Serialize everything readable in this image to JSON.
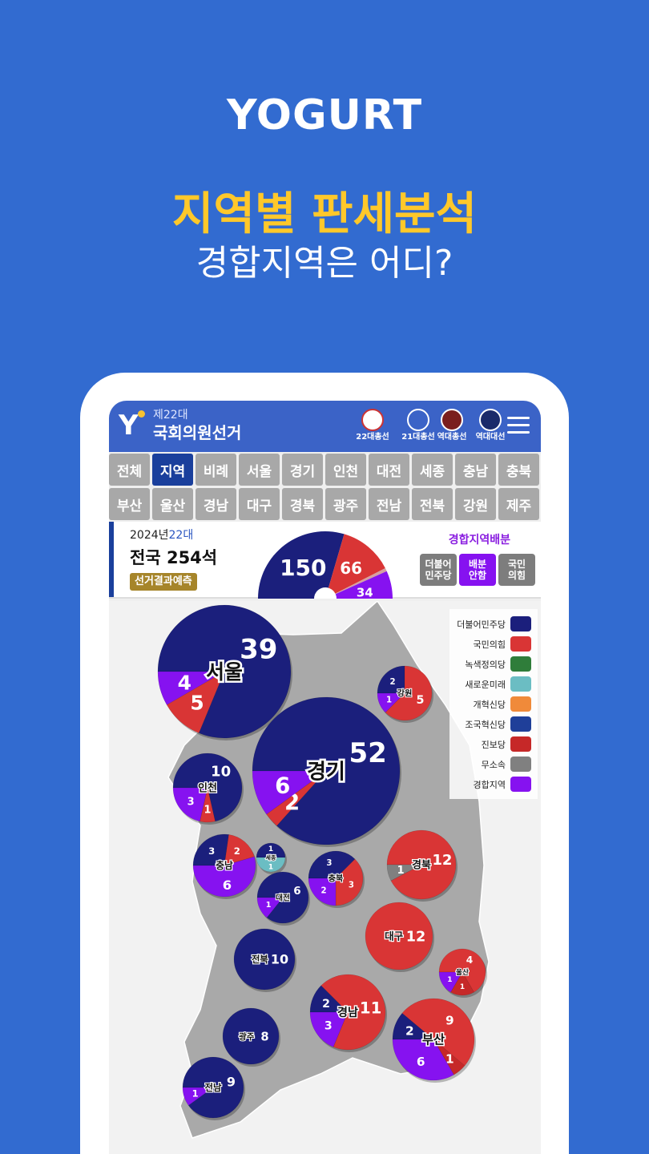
{
  "brand": "YOGURT",
  "headline": "지역별 판세분석",
  "subline": "경합지역은 어디?",
  "app": {
    "title_small": "제22대",
    "title": "국회의원선거",
    "icons": [
      {
        "name": "ballot-icon",
        "label": "22대총선"
      },
      {
        "name": "assembly-icon",
        "label": "21대총선"
      },
      {
        "name": "seal-icon",
        "label": "역대총선"
      },
      {
        "name": "emblem-icon",
        "label": "역대대선"
      }
    ]
  },
  "tabs": [
    [
      "전체",
      "지역",
      "비례",
      "서울",
      "경기",
      "인천",
      "대전",
      "세종",
      "충남",
      "충북"
    ],
    [
      "부산",
      "울산",
      "경남",
      "대구",
      "경북",
      "광주",
      "전남",
      "전북",
      "강원",
      "제주"
    ]
  ],
  "selected_tab": "지역",
  "summary": {
    "year": "2024년",
    "term": "22대",
    "total": "전국 254석",
    "predict": "선거결과예측",
    "contested_title": "경합지역배분",
    "buttons": [
      "더불어\n민주당",
      "배분\n안함",
      "국민\n의힘"
    ],
    "selected_button": "배분\n안함"
  },
  "colors": {
    "더불어민주당": "#1b1f7c",
    "국민의힘": "#d93535",
    "녹색정의당": "#2f7d3a",
    "새로운미래": "#6bbdc3",
    "개혁신당": "#f08a3a",
    "조국혁신당": "#1f3f99",
    "진보당": "#c62828",
    "무소속": "#808080",
    "경합지역": "#8612f0"
  },
  "legend": [
    "더불어민주당",
    "국민의힘",
    "녹색정의당",
    "새로운미래",
    "개혁신당",
    "조국혁신당",
    "진보당",
    "무소속",
    "경합지역"
  ],
  "chart_data": [
    {
      "type": "pie",
      "title": "전국 254석",
      "shape": "semicircle",
      "slices": [
        {
          "party": "더불어민주당",
          "value": 150
        },
        {
          "party": "국민의힘",
          "value": 66
        },
        {
          "party": "기타",
          "value": 4
        },
        {
          "party": "경합지역",
          "value": 34
        }
      ]
    },
    {
      "type": "pie",
      "regions": [
        {
          "region": "서울",
          "slices": [
            {
              "party": "더불어민주당",
              "value": 39
            },
            {
              "party": "국민의힘",
              "value": 5
            },
            {
              "party": "경합지역",
              "value": 4
            }
          ]
        },
        {
          "region": "강원",
          "slices": [
            {
              "party": "더불어민주당",
              "value": 2
            },
            {
              "party": "국민의힘",
              "value": 5
            },
            {
              "party": "경합지역",
              "value": 1
            }
          ]
        },
        {
          "region": "경기",
          "slices": [
            {
              "party": "더불어민주당",
              "value": 52
            },
            {
              "party": "국민의힘",
              "value": 2
            },
            {
              "party": "경합지역",
              "value": 6
            }
          ]
        },
        {
          "region": "인천",
          "slices": [
            {
              "party": "더불어민주당",
              "value": 10
            },
            {
              "party": "국민의힘",
              "value": 1
            },
            {
              "party": "경합지역",
              "value": 3
            }
          ]
        },
        {
          "region": "충남",
          "slices": [
            {
              "party": "더불어민주당",
              "value": 3
            },
            {
              "party": "국민의힘",
              "value": 2
            },
            {
              "party": "경합지역",
              "value": 6
            }
          ]
        },
        {
          "region": "세종",
          "slices": [
            {
              "party": "더불어민주당",
              "value": 1
            },
            {
              "party": "새로운미래",
              "value": 1
            }
          ]
        },
        {
          "region": "대전",
          "slices": [
            {
              "party": "더불어민주당",
              "value": 6
            },
            {
              "party": "경합지역",
              "value": 1
            }
          ]
        },
        {
          "region": "충북",
          "slices": [
            {
              "party": "더불어민주당",
              "value": 3
            },
            {
              "party": "국민의힘",
              "value": 3
            },
            {
              "party": "경합지역",
              "value": 2
            }
          ]
        },
        {
          "region": "경북",
          "slices": [
            {
              "party": "국민의힘",
              "value": 12
            },
            {
              "party": "무소속",
              "value": 1
            }
          ]
        },
        {
          "region": "대구",
          "slices": [
            {
              "party": "국민의힘",
              "value": 12
            }
          ]
        },
        {
          "region": "전북",
          "slices": [
            {
              "party": "더불어민주당",
              "value": 10
            }
          ]
        },
        {
          "region": "울산",
          "slices": [
            {
              "party": "국민의힘",
              "value": 4
            },
            {
              "party": "진보당",
              "value": 1
            },
            {
              "party": "경합지역",
              "value": 1
            }
          ]
        },
        {
          "region": "경남",
          "slices": [
            {
              "party": "더불어민주당",
              "value": 2
            },
            {
              "party": "국민의힘",
              "value": 11
            },
            {
              "party": "경합지역",
              "value": 3
            }
          ]
        },
        {
          "region": "부산",
          "slices": [
            {
              "party": "더불어민주당",
              "value": 2
            },
            {
              "party": "국민의힘",
              "value": 9
            },
            {
              "party": "진보당",
              "value": 1
            },
            {
              "party": "경합지역",
              "value": 6
            }
          ]
        },
        {
          "region": "광주",
          "slices": [
            {
              "party": "더불어민주당",
              "value": 8
            }
          ]
        },
        {
          "region": "전남",
          "slices": [
            {
              "party": "더불어민주당",
              "value": 9
            },
            {
              "party": "경합지역",
              "value": 1
            }
          ]
        }
      ]
    }
  ]
}
